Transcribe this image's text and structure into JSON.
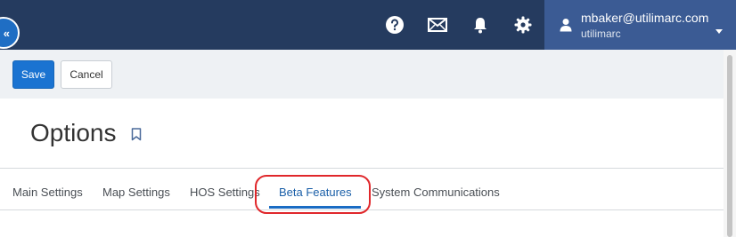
{
  "header": {
    "collapse_label": "«",
    "icons": [
      "help-icon",
      "mail-icon",
      "bell-icon",
      "gear-icon"
    ],
    "user": {
      "email": "mbaker@utilimarc.com",
      "org": "utilimarc"
    }
  },
  "toolbar": {
    "save_label": "Save",
    "cancel_label": "Cancel"
  },
  "page": {
    "title": "Options"
  },
  "tabs": [
    {
      "label": "Main Settings"
    },
    {
      "label": "Map Settings"
    },
    {
      "label": "HOS Settings"
    },
    {
      "label": "Beta Features",
      "active": true
    },
    {
      "label": "System Communications"
    }
  ],
  "colors": {
    "header_bg": "#253b5f",
    "user_area_bg": "#3b5b94",
    "primary": "#1a73d1",
    "highlight": "#e0272b"
  }
}
